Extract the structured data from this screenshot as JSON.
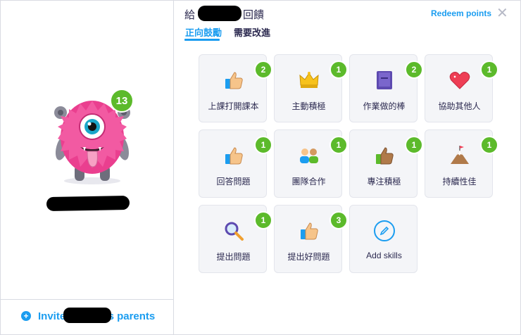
{
  "header": {
    "title_prefix": "給",
    "title_suffix": "回饋",
    "redeem_label": "Redeem points",
    "close_glyph": "✕"
  },
  "tabs": [
    {
      "label": "正向鼓勵",
      "active": true
    },
    {
      "label": "需要改進",
      "active": false
    }
  ],
  "student": {
    "points": "13",
    "avatar": "pink-monster"
  },
  "invite": {
    "prefix": "Invite",
    "suffix": "'s parents"
  },
  "skills": [
    {
      "label": "上課打開課本",
      "count": "2",
      "icon": "thumbs-up-icon"
    },
    {
      "label": "主動積極",
      "count": "1",
      "icon": "crown-icon"
    },
    {
      "label": "作業做的棒",
      "count": "2",
      "icon": "book-icon"
    },
    {
      "label": "協助其他人",
      "count": "1",
      "icon": "heart-icon"
    },
    {
      "label": "回答問題",
      "count": "1",
      "icon": "thumbs-up-icon"
    },
    {
      "label": "團隊合作",
      "count": "1",
      "icon": "team-icon"
    },
    {
      "label": "專注積極",
      "count": "1",
      "icon": "thumbs-up-icon"
    },
    {
      "label": "持續性佳",
      "count": "1",
      "icon": "mountain-flag-icon"
    },
    {
      "label": "提出問題",
      "count": "1",
      "icon": "magnifier-icon"
    },
    {
      "label": "提出好問題",
      "count": "3",
      "icon": "thumbs-up-icon"
    }
  ],
  "add_skill": {
    "label": "Add skills"
  },
  "colors": {
    "accent": "#1b9df0",
    "badge": "#5cba2b",
    "text": "#2c2a50",
    "card_bg": "#f4f5f8"
  }
}
